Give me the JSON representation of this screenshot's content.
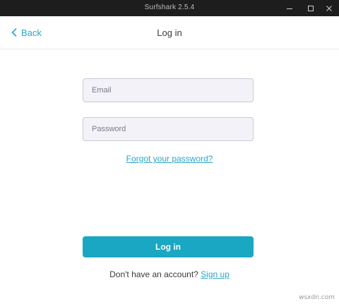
{
  "window": {
    "title": "Surfshark 2.5.4"
  },
  "header": {
    "back_label": "Back",
    "title": "Log in"
  },
  "form": {
    "email_placeholder": "Email",
    "password_placeholder": "Password",
    "forgot_label": "Forgot your password?",
    "login_label": "Log in",
    "no_account_text": "Don't have an account?",
    "signup_label": "Sign up"
  },
  "watermark": "wsxdn.com",
  "colors": {
    "accent": "#1aa7c2",
    "link": "#2aa7c9",
    "titlebar": "#1d1d1d",
    "field_bg": "#f3f2f8"
  },
  "icons": {
    "back": "chevron-left-icon",
    "minimize": "minimize-icon",
    "maximize": "maximize-icon",
    "close": "close-icon"
  }
}
